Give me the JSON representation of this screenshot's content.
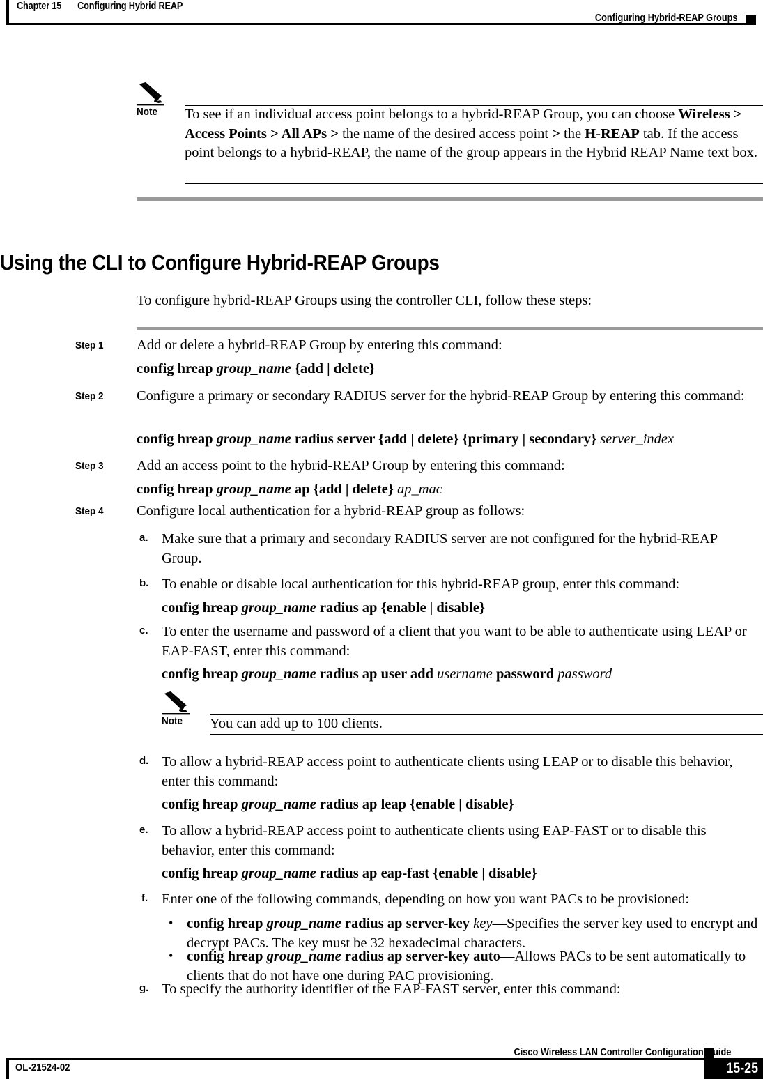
{
  "header": {
    "chapter_number": "Chapter 15",
    "chapter_title": "Configuring Hybrid REAP",
    "section_title": "Configuring Hybrid-REAP Groups"
  },
  "notes": {
    "note_label": "Note",
    "note1_text": "To see if an individual access point belongs to a hybrid-REAP Group, you can choose Wireless > Access Points > All APs > the name of the desired access point > the H-REAP tab. If the access point belongs to a hybrid-REAP, the name of the group appears in the Hybrid REAP Name text box.",
    "note2_text": "You can add up to 100 clients."
  },
  "section": {
    "heading": "Using the CLI to Configure Hybrid-REAP Groups",
    "intro": "To configure hybrid-REAP Groups using the controller CLI, follow these steps:"
  },
  "steps": [
    {
      "label": "Step 1",
      "text": "Add or delete a hybrid-REAP Group by entering this command:",
      "command": "config hreap group_name {add | delete}"
    },
    {
      "label": "Step 2",
      "text": "Configure a primary or secondary RADIUS server for the hybrid-REAP Group by entering this command:",
      "command": "config hreap group_name radius server {add | delete} {primary | secondary} server_index"
    },
    {
      "label": "Step 3",
      "text": "Add an access point to the hybrid-REAP Group by entering this command:",
      "command": "config hreap group_name ap {add | delete} ap_mac"
    },
    {
      "label": "Step 4",
      "text": "Configure local authentication for a hybrid-REAP group as follows:"
    }
  ],
  "substeps": [
    {
      "label": "a.",
      "text": "Make sure that a primary and secondary RADIUS server are not configured for the hybrid-REAP Group."
    },
    {
      "label": "b.",
      "text": "To enable or disable local authentication for this hybrid-REAP group, enter this command:",
      "command": "config hreap group_name radius ap {enable | disable}"
    },
    {
      "label": "c.",
      "text": "To enter the username and password of a client that you want to be able to authenticate using LEAP or EAP-FAST, enter this command:",
      "command": "config hreap group_name radius ap user add username password password"
    },
    {
      "label": "d.",
      "text": "To allow a hybrid-REAP access point to authenticate clients using LEAP or to disable this behavior, enter this command:",
      "command": "config hreap group_name radius ap leap {enable | disable}"
    },
    {
      "label": "e.",
      "text": "To allow a hybrid-REAP access point to authenticate clients using EAP-FAST or to disable this behavior, enter this command:",
      "command": "config hreap group_name radius ap eap-fast {enable | disable}"
    },
    {
      "label": "f.",
      "text": "Enter one of the following commands, depending on how you want PACs to be provisioned:"
    },
    {
      "label": "g.",
      "text": "To specify the authority identifier of the EAP-FAST server, enter this command:"
    }
  ],
  "bullets": [
    {
      "marker": "•",
      "command": "config hreap group_name radius ap server-key key",
      "description": "—Specifies the server key used to encrypt and decrypt PACs. The key must be 32 hexadecimal characters."
    },
    {
      "marker": "•",
      "command": "config hreap group_name radius ap server-key auto",
      "description": "—Allows PACs to be sent automatically to clients that do not have one during PAC provisioning."
    }
  ],
  "footer": {
    "guide_title": "Cisco Wireless LAN Controller Configuration Guide",
    "doc_id": "OL-21524-02",
    "page_number": "15-25"
  }
}
